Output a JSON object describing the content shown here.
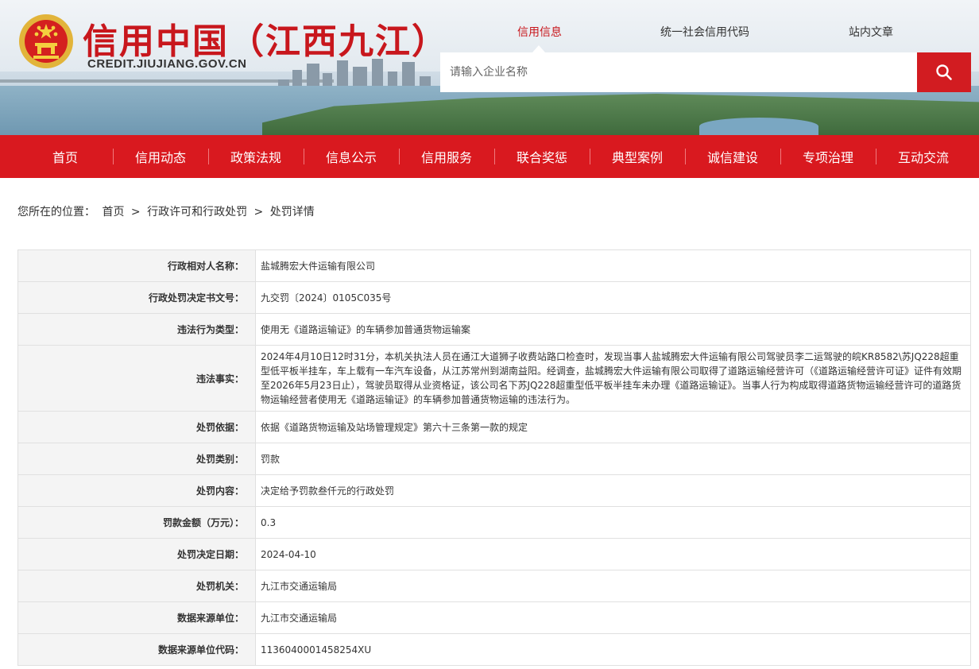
{
  "header": {
    "site_title": "信用中国（江西九江）",
    "site_domain": "CREDIT.JIUJIANG.GOV.CN",
    "emblem_icon": "national-emblem-icon",
    "top_tabs": [
      "信用信息",
      "统一社会信用代码",
      "站内文章"
    ],
    "active_tab": "信用信息",
    "search": {
      "placeholder": "请输入企业名称",
      "button_icon": "search-icon"
    }
  },
  "nav": {
    "items": [
      "首页",
      "信用动态",
      "政策法规",
      "信息公示",
      "信用服务",
      "联合奖惩",
      "典型案例",
      "诚信建设",
      "专项治理",
      "互动交流"
    ]
  },
  "breadcrumb": {
    "prefix": "您所在的位置：",
    "items": [
      "首页",
      "行政许可和行政处罚",
      "处罚详情"
    ],
    "separator": ">"
  },
  "detail": {
    "rows": [
      {
        "label": "行政相对人名称：",
        "value": "盐城腾宏大件运输有限公司"
      },
      {
        "label": "行政处罚决定书文号：",
        "value": "九交罚〔2024〕0105C035号"
      },
      {
        "label": "违法行为类型：",
        "value": "使用无《道路运输证》的车辆参加普通货物运输案"
      },
      {
        "label": "违法事实：",
        "value": "2024年4月10日12时31分，本机关执法人员在通江大道狮子收费站路口检查时，发现当事人盐城腾宏大件运输有限公司驾驶员李二运驾驶的皖KR8582\\苏JQ228超重型低平板半挂车，车上载有一车汽车设备，从江苏常州到湖南益阳。经调查，盐城腾宏大件运输有限公司取得了道路运输经营许可（《道路运输经营许可证》证件有效期至2026年5月23日止），驾驶员取得从业资格证，该公司名下苏JQ228超重型低平板半挂车未办理《道路运输证》。当事人行为构成取得道路货物运输经营许可的道路货物运输经营者使用无《道路运输证》的车辆参加普通货物运输的违法行为。"
      },
      {
        "label": "处罚依据：",
        "value": "依据《道路货物运输及站场管理规定》第六十三条第一款的规定"
      },
      {
        "label": "处罚类别：",
        "value": "罚款"
      },
      {
        "label": "处罚内容：",
        "value": "决定给予罚款叁仟元的行政处罚"
      },
      {
        "label": "罚款金额（万元）：",
        "value": "0.3"
      },
      {
        "label": "处罚决定日期：",
        "value": "2024-04-10"
      },
      {
        "label": "处罚机关：",
        "value": "九江市交通运输局"
      },
      {
        "label": "数据来源单位：",
        "value": "九江市交通运输局"
      },
      {
        "label": "数据来源单位代码：",
        "value": "1136040001458254XU"
      }
    ]
  },
  "colors": {
    "brand_red": "#d9191f",
    "title_red": "#c8171d",
    "label_bg": "#f4f4f4"
  }
}
